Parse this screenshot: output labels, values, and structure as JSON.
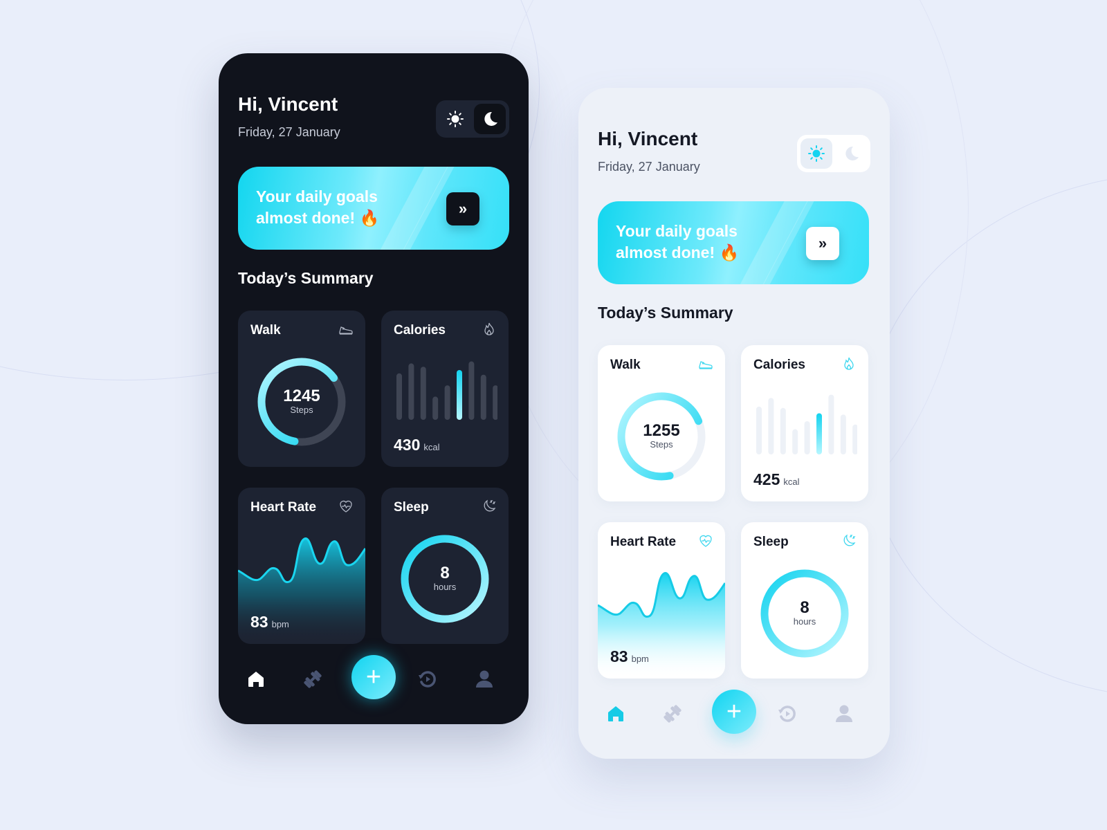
{
  "accent": "#16d6f0",
  "screens": {
    "dark": {
      "theme": "dark",
      "greeting": "Hi, Vincent",
      "date": "Friday, 27 January",
      "theme_toggle": {
        "selected": "dark",
        "options": [
          "sun-icon",
          "moon-icon"
        ]
      },
      "banner": {
        "line1": "Your daily goals",
        "line2": "almost done! 🔥",
        "button_icon": "»"
      },
      "section_title": "Today’s Summary",
      "walk": {
        "title": "Walk",
        "icon": "sneaker-icon",
        "steps": "1245",
        "label": "Steps",
        "progress": 0.62
      },
      "calories": {
        "title": "Calories",
        "icon": "flame-icon",
        "value": "430",
        "unit": "kcal",
        "bars": [
          0.7,
          0.85,
          0.8,
          0.35,
          0.52,
          0.75,
          0.88,
          0.68,
          0.52
        ],
        "highlight_index": 5
      },
      "heart": {
        "title": "Heart Rate",
        "icon": "heart-pulse-icon",
        "value": "83",
        "unit": "bpm"
      },
      "sleep": {
        "title": "Sleep",
        "icon": "moon-zzz-icon",
        "value": "8",
        "label": "hours",
        "progress": 1.0
      },
      "nav": {
        "active": "home",
        "items": [
          "home-icon",
          "dumbbell-icon",
          "add-icon",
          "history-icon",
          "profile-icon"
        ],
        "fab_label": "+"
      }
    },
    "light": {
      "theme": "light",
      "greeting": "Hi, Vincent",
      "date": "Friday, 27 January",
      "theme_toggle": {
        "selected": "light",
        "options": [
          "sun-icon",
          "moon-icon"
        ]
      },
      "banner": {
        "line1": "Your daily goals",
        "line2": "almost done! 🔥",
        "button_icon": "»"
      },
      "section_title": "Today’s Summary",
      "walk": {
        "title": "Walk",
        "icon": "sneaker-icon",
        "steps": "1255",
        "label": "Steps",
        "progress": 0.72
      },
      "calories": {
        "title": "Calories",
        "icon": "flame-icon",
        "value": "425",
        "unit": "kcal",
        "bars": [
          0.72,
          0.85,
          0.7,
          0.38,
          0.5,
          0.62,
          0.9,
          0.6,
          0.45
        ],
        "highlight_index": 5
      },
      "heart": {
        "title": "Heart Rate",
        "icon": "heart-pulse-icon",
        "value": "83",
        "unit": "bpm"
      },
      "sleep": {
        "title": "Sleep",
        "icon": "moon-zzz-icon",
        "value": "8",
        "label": "hours",
        "progress": 1.0
      },
      "nav": {
        "active": "home",
        "items": [
          "home-icon",
          "dumbbell-icon",
          "add-icon",
          "history-icon",
          "profile-icon"
        ],
        "fab_label": "+"
      }
    }
  }
}
